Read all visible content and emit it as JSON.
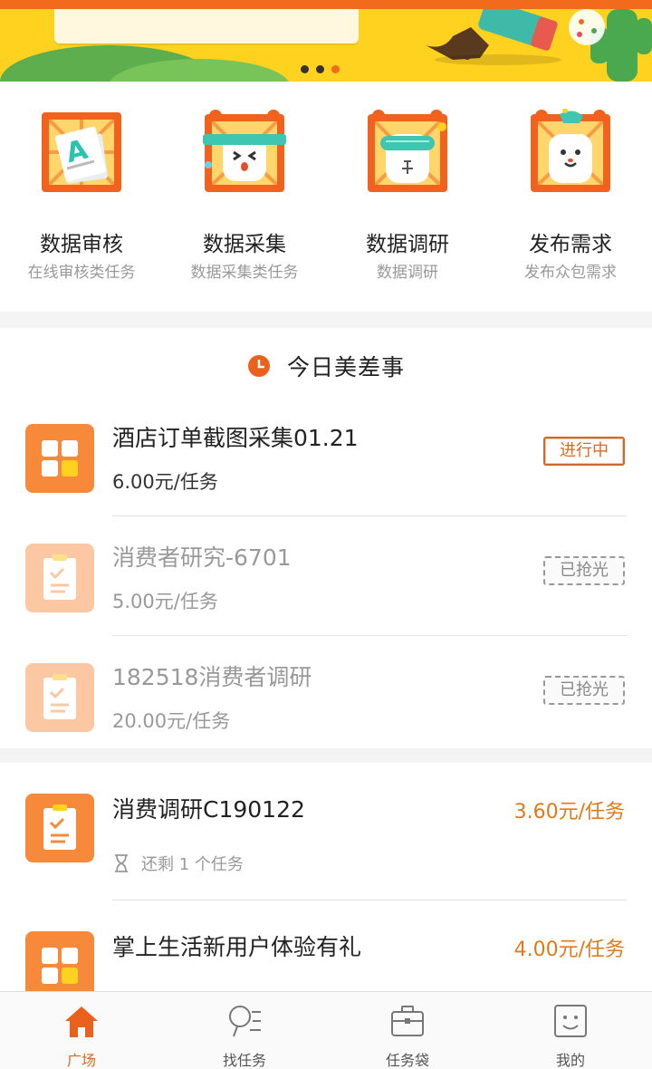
{
  "colors": {
    "accent": "#f26a1b",
    "price": "#e07a1a",
    "banner": "#ffd21f"
  },
  "banner": {
    "slide_count": 3,
    "active_slide": 3
  },
  "categories": [
    {
      "title": "数据审核",
      "subtitle": "在线审核类任务",
      "icon": "audit-document-icon"
    },
    {
      "title": "数据采集",
      "subtitle": "数据采集类任务",
      "icon": "collect-tiger-icon"
    },
    {
      "title": "数据调研",
      "subtitle": "数据调研",
      "icon": "research-tiger-icon"
    },
    {
      "title": "发布需求",
      "subtitle": "发布众包需求",
      "icon": "publish-tiger-icon"
    }
  ],
  "today": {
    "title": "今日美差事",
    "tasks": [
      {
        "name": "酒店订单截图采集01.21",
        "price": "6.00元/任务",
        "status": "进行中"
      },
      {
        "name": "消费者研究-6701",
        "price": "5.00元/任务",
        "status": "已抢光"
      },
      {
        "name": "182518消费者调研",
        "price": "20.00元/任务",
        "status": "已抢光"
      }
    ]
  },
  "list": {
    "items": [
      {
        "name": "消费调研C190122",
        "price": "3.60元/任务",
        "remaining": "还剩 1 个任务"
      },
      {
        "name": "掌上生活新用户体验有礼",
        "price": "4.00元/任务"
      }
    ]
  },
  "tabbar": {
    "tabs": [
      {
        "label": "广场",
        "icon": "home-icon",
        "active": true
      },
      {
        "label": "找任务",
        "icon": "search-list-icon",
        "active": false
      },
      {
        "label": "任务袋",
        "icon": "briefcase-icon",
        "active": false
      },
      {
        "label": "我的",
        "icon": "smiley-profile-icon",
        "active": false
      }
    ]
  }
}
